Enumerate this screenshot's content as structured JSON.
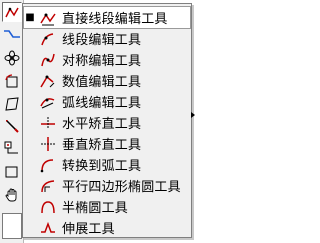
{
  "colors": {
    "icon_red": "#c00000",
    "icon_black": "#000000",
    "menu_bg": "#f0f0f0",
    "selected_bg": "#ffffff"
  },
  "toolbar": {
    "buttons": [
      {
        "icon": "line-curve-tool-icon"
      },
      {
        "icon": "step-line-tool-icon"
      },
      {
        "icon": "four-petal-tool-icon"
      },
      {
        "icon": "rotate-square-tool-icon"
      },
      {
        "icon": "parallelogram-tool-icon"
      },
      {
        "icon": "pen-tool-icon"
      },
      {
        "icon": "connector-tool-icon"
      },
      {
        "icon": "rectangle-tool-icon"
      },
      {
        "icon": "hand-tool-icon"
      }
    ]
  },
  "menu": {
    "items": [
      {
        "label": "直接线段编辑工具",
        "icon": "direct-segment-edit-icon",
        "checked": "■",
        "selected": true
      },
      {
        "label": "线段编辑工具",
        "icon": "segment-edit-icon",
        "checked": "",
        "selected": false
      },
      {
        "label": "对称编辑工具",
        "icon": "symmetric-edit-icon",
        "checked": "",
        "selected": false
      },
      {
        "label": "数值编辑工具",
        "icon": "numeric-edit-icon",
        "checked": "",
        "selected": false
      },
      {
        "label": "弧线编辑工具",
        "icon": "arc-edit-icon",
        "checked": "",
        "selected": false
      },
      {
        "label": "水平矫直工具",
        "icon": "horizontal-straighten-icon",
        "checked": "",
        "selected": false
      },
      {
        "label": "垂直矫直工具",
        "icon": "vertical-straighten-icon",
        "checked": "",
        "selected": false
      },
      {
        "label": "转换到弧工具",
        "icon": "convert-to-arc-icon",
        "checked": "",
        "selected": false
      },
      {
        "label": "平行四边形椭圆工具",
        "icon": "parallelogram-ellipse-icon",
        "checked": "",
        "selected": false
      },
      {
        "label": "半椭圆工具",
        "icon": "half-ellipse-icon",
        "checked": "",
        "selected": false
      },
      {
        "label": "伸展工具",
        "icon": "stretch-icon",
        "checked": "",
        "selected": false
      }
    ]
  }
}
